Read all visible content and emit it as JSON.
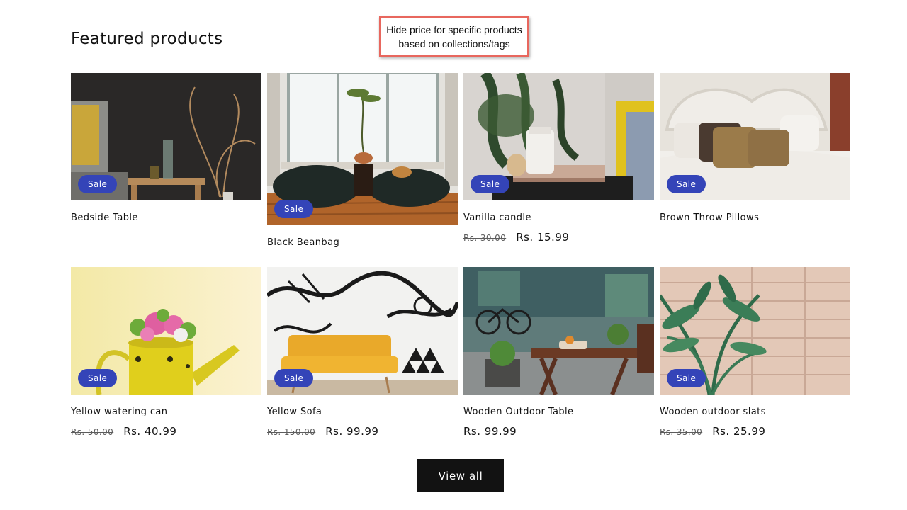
{
  "section": {
    "title": "Featured products"
  },
  "callout": {
    "line1": "Hide price for specific products",
    "line2": "based on collections/tags",
    "border_color": "#e8675e"
  },
  "badge": {
    "label": "Sale",
    "color": "#3444b8"
  },
  "products": [
    {
      "title": "Bedside Table",
      "sale": true,
      "compare_price": "",
      "price": "",
      "image": "bedside-table-image"
    },
    {
      "title": "Black Beanbag",
      "sale": true,
      "compare_price": "",
      "price": "",
      "image": "black-beanbag-image"
    },
    {
      "title": "Vanilla candle",
      "sale": true,
      "compare_price": "Rs. 30.00",
      "price": "Rs. 15.99",
      "image": "vanilla-candle-image"
    },
    {
      "title": "Brown Throw Pillows",
      "sale": true,
      "compare_price": "",
      "price": "",
      "image": "brown-throw-pillows-image"
    },
    {
      "title": "Yellow watering can",
      "sale": true,
      "compare_price": "Rs. 50.00",
      "price": "Rs. 40.99",
      "image": "yellow-watering-can-image"
    },
    {
      "title": "Yellow Sofa",
      "sale": true,
      "compare_price": "Rs. 150.00",
      "price": "Rs. 99.99",
      "image": "yellow-sofa-image"
    },
    {
      "title": "Wooden Outdoor Table",
      "sale": false,
      "compare_price": "",
      "price": "Rs. 99.99",
      "image": "wooden-outdoor-table-image"
    },
    {
      "title": "Wooden outdoor slats",
      "sale": true,
      "compare_price": "Rs. 35.00",
      "price": "Rs. 25.99",
      "image": "wooden-outdoor-slats-image"
    }
  ],
  "view_all": {
    "label": "View all"
  }
}
